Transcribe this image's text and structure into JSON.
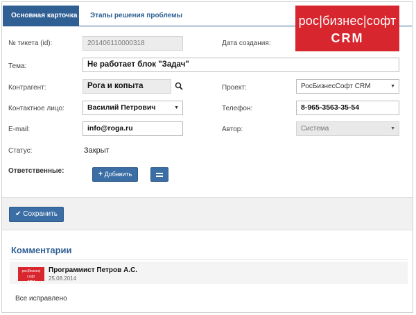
{
  "tabs": [
    {
      "label": "Основная карточка",
      "active": true
    },
    {
      "label": "Этапы решения проблемы",
      "active": false
    }
  ],
  "logo": {
    "line1": "рос|бизнес|софт",
    "line2": "CRM"
  },
  "form": {
    "ticket_id": {
      "label": "№ тикета (id):",
      "value": "201406110000318"
    },
    "created": {
      "label": "Дата создания:",
      "value": ""
    },
    "subject": {
      "label": "Тема:",
      "value": "Не работает блок \"Задач\""
    },
    "counterparty": {
      "label": "Контрагент:",
      "value": "Рога и копыта"
    },
    "project": {
      "label": "Проект:",
      "value": "РосБизнесСофт CRM"
    },
    "contact": {
      "label": "Контактное лицо:",
      "value": "Василий Петрович"
    },
    "phone": {
      "label": "Телефон:",
      "value": "8-965-3563-35-54"
    },
    "email": {
      "label": "E-mail:",
      "value": "info@roga.ru"
    },
    "author": {
      "label": "Автор:",
      "value": "Система"
    },
    "status": {
      "label": "Статус:",
      "value": "Закрыт"
    },
    "responsible": {
      "label": "Ответственные:",
      "add_label": "Добавить"
    }
  },
  "actions": {
    "save_label": "Сохранить"
  },
  "comments": {
    "title": "Комментарии",
    "items": [
      {
        "author": "Программист Петров А.С.",
        "date": "25.08.2014",
        "text": "Все исправлено"
      }
    ]
  },
  "colors": {
    "accent": "#2f5f93",
    "brand": "#d7262e",
    "button": "#3a6ea5"
  }
}
